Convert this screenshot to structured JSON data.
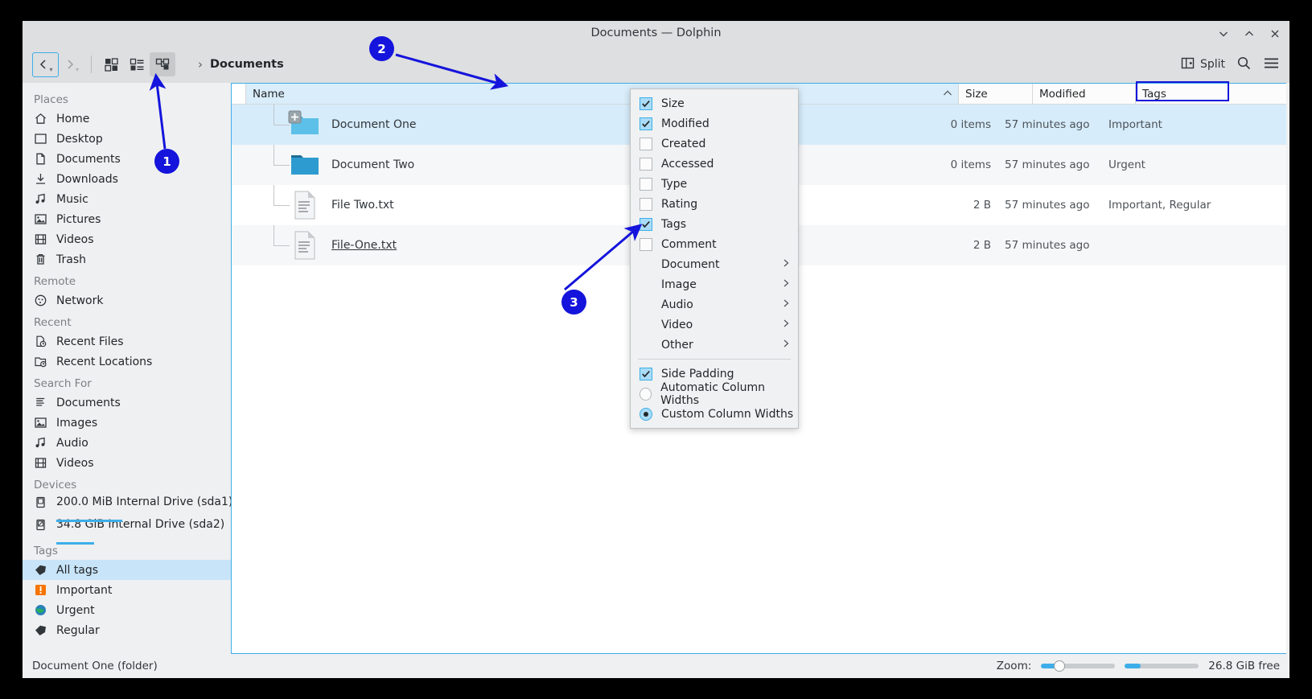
{
  "window": {
    "title": "Documents — Dolphin",
    "controls": [
      {
        "name": "minimize",
        "glyph": "chevron-down"
      },
      {
        "name": "maximize",
        "glyph": "chevron-up"
      },
      {
        "name": "close",
        "glyph": "x"
      }
    ]
  },
  "toolbar": {
    "back_label": "",
    "forward_label": "",
    "view_modes": [
      "icons-view",
      "compact-view",
      "details-view"
    ],
    "active_view_mode": "details-view",
    "breadcrumb": {
      "chevron": "›",
      "path": "Documents"
    },
    "split_label": "Split",
    "search_label": "",
    "menu_label": ""
  },
  "sidebar": {
    "groups": [
      {
        "title": "Places",
        "items": [
          {
            "label": "Home",
            "icon": "home-icon"
          },
          {
            "label": "Desktop",
            "icon": "desktop-icon"
          },
          {
            "label": "Documents",
            "icon": "documents-icon"
          },
          {
            "label": "Downloads",
            "icon": "downloads-icon"
          },
          {
            "label": "Music",
            "icon": "music-icon"
          },
          {
            "label": "Pictures",
            "icon": "pictures-icon"
          },
          {
            "label": "Videos",
            "icon": "videos-icon"
          },
          {
            "label": "Trash",
            "icon": "trash-icon"
          }
        ]
      },
      {
        "title": "Remote",
        "items": [
          {
            "label": "Network",
            "icon": "network-icon"
          }
        ]
      },
      {
        "title": "Recent",
        "items": [
          {
            "label": "Recent Files",
            "icon": "recent-files-icon"
          },
          {
            "label": "Recent Locations",
            "icon": "recent-locations-icon"
          }
        ]
      },
      {
        "title": "Search For",
        "items": [
          {
            "label": "Documents",
            "icon": "search-documents-icon"
          },
          {
            "label": "Images",
            "icon": "search-images-icon"
          },
          {
            "label": "Audio",
            "icon": "search-audio-icon"
          },
          {
            "label": "Videos",
            "icon": "search-videos-icon"
          }
        ]
      },
      {
        "title": "Devices",
        "items": [
          {
            "label": "200.0 MiB Internal Drive (sda1)",
            "icon": "drive-icon",
            "usage_percent": 40
          },
          {
            "label": "34.8 GiB Internal Drive (sda2)",
            "icon": "drive-icon",
            "usage_percent": 23
          }
        ]
      },
      {
        "title": "Tags",
        "items": [
          {
            "label": "All tags",
            "icon": "tag-icon",
            "selected": true
          },
          {
            "label": "Important",
            "icon": "important-tag-icon"
          },
          {
            "label": "Urgent",
            "icon": "urgent-tag-icon"
          },
          {
            "label": "Regular",
            "icon": "regular-tag-icon"
          }
        ]
      }
    ]
  },
  "file_view": {
    "columns": [
      {
        "key": "name",
        "label": "Name",
        "sorted": true
      },
      {
        "key": "size",
        "label": "Size"
      },
      {
        "key": "modified",
        "label": "Modified"
      },
      {
        "key": "tags",
        "label": "Tags",
        "highlighted": true
      }
    ],
    "rows": [
      {
        "name": "Document One",
        "icon": "folder-expandable-icon",
        "size": "0 items",
        "modified": "57 minutes ago",
        "tags": "Important",
        "selected": true
      },
      {
        "name": "Document Two",
        "icon": "folder-icon",
        "size": "0 items",
        "modified": "57 minutes ago",
        "tags": "Urgent",
        "selected": false
      },
      {
        "name": "File Two.txt",
        "icon": "text-file-icon",
        "size": "2 B",
        "modified": "57 minutes ago",
        "tags": "Important, Regular",
        "selected": false
      },
      {
        "name": "File-One.txt",
        "icon": "text-file-icon",
        "size": "2 B",
        "modified": "57 minutes ago",
        "tags": "",
        "selected": false,
        "underlined": true
      }
    ]
  },
  "context_menu": {
    "items": [
      {
        "label": "Size",
        "type": "checkbox",
        "checked": true
      },
      {
        "label": "Modified",
        "type": "checkbox",
        "checked": true
      },
      {
        "label": "Created",
        "type": "checkbox",
        "checked": false
      },
      {
        "label": "Accessed",
        "type": "checkbox",
        "checked": false
      },
      {
        "label": "Type",
        "type": "checkbox",
        "checked": false
      },
      {
        "label": "Rating",
        "type": "checkbox",
        "checked": false
      },
      {
        "label": "Tags",
        "type": "checkbox",
        "checked": true
      },
      {
        "label": "Comment",
        "type": "checkbox",
        "checked": false
      },
      {
        "label": "Document",
        "type": "submenu"
      },
      {
        "label": "Image",
        "type": "submenu"
      },
      {
        "label": "Audio",
        "type": "submenu"
      },
      {
        "label": "Video",
        "type": "submenu"
      },
      {
        "label": "Other",
        "type": "submenu"
      },
      {
        "label": "Side Padding",
        "type": "checkbox",
        "checked": true,
        "separator_above": true
      },
      {
        "label": "Automatic Column Widths",
        "type": "radio",
        "checked": false
      },
      {
        "label": "Custom Column Widths",
        "type": "radio",
        "checked": true
      }
    ]
  },
  "statusbar": {
    "selection_text": "Document One (folder)",
    "zoom_label": "Zoom:",
    "zoom_percent": 22,
    "scroll_percent": 20,
    "free_space": "26.8 GiB free"
  },
  "annotations": [
    {
      "number": "1",
      "target": "details-view-button"
    },
    {
      "number": "2",
      "target": "column-header-area"
    },
    {
      "number": "3",
      "target": "tags-checkbox-menu-item"
    }
  ],
  "colors": {
    "accent": "#3daee9",
    "annotation": "#1414dc",
    "selection": "#d6ecfb",
    "window_bg": "#eff0f1"
  }
}
